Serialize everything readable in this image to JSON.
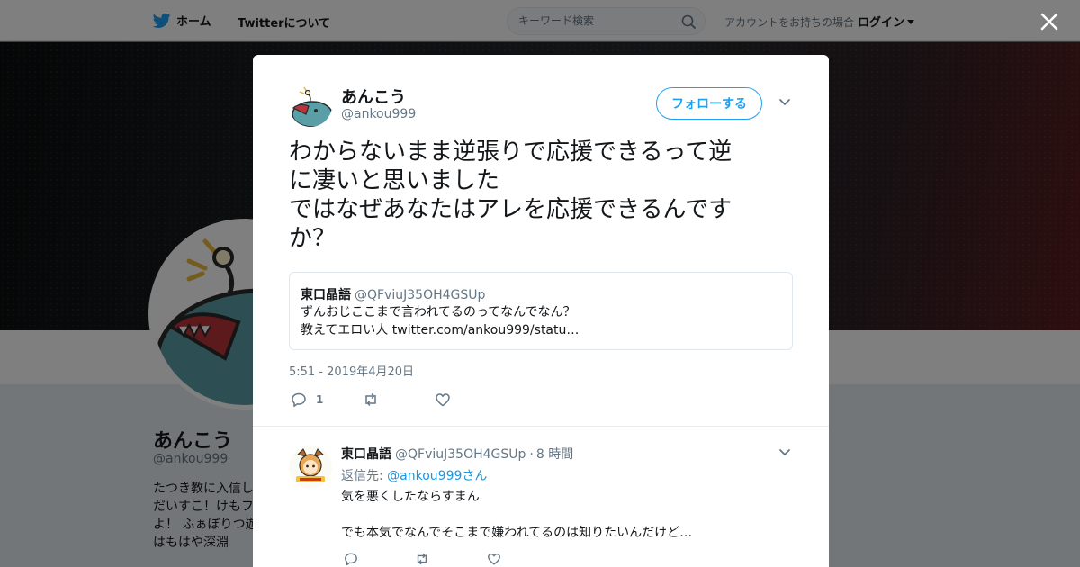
{
  "nav": {
    "home_label": "ホーム",
    "about_label": "Twitterについて",
    "search_placeholder": "キーワード検索",
    "account_prompt": "アカウントをお持ちの場合",
    "login_label": "ログイン"
  },
  "profile": {
    "name": "あんこう",
    "handle": "@ankou999",
    "bio_lines": [
      "たつき教に入信し",
      "だいすこ！けもフ",
      "よ！ ふぁぼりつ遊",
      "はもはや深淵"
    ]
  },
  "tweet": {
    "author_name": "あんこう",
    "author_handle": "@ankou999",
    "follow_label": "フォローする",
    "text": "わからないまま逆張りで応援できるって逆\nに凄いと思いました\nではなぜあなたはアレを応援できるんです\nか？",
    "quote": {
      "name": "東口晶語",
      "handle": "@QFviuJ35OH4GSUp",
      "text": "ずんおじここまで言われてるのってなんでなん？\n教えてエロい人 twitter.com/ankou999/statu…"
    },
    "timestamp": "5:51 - 2019年4月20日",
    "reply_count": "1",
    "retweet_count": "",
    "like_count": ""
  },
  "reply": {
    "name": "東口晶語",
    "handle": "@QFviuJ35OH4GSUp",
    "separator": "·",
    "time": "8 時間",
    "reply_to_prefix": "返信先: ",
    "reply_to_handle": "@ankou999",
    "reply_to_suffix": "さん",
    "text": "気を悪くしたならすまん\n\nでも本気でなんでそこまで嫌われてるのは知りたいんだけど…"
  },
  "colors": {
    "accent": "#1da1f2",
    "link": "#1b95e0",
    "text": "#14171a",
    "secondary": "#657786"
  },
  "icons": [
    "twitter-bird-icon",
    "search-icon",
    "close-icon",
    "chevron-down-icon",
    "reply-icon",
    "retweet-icon",
    "like-icon"
  ]
}
